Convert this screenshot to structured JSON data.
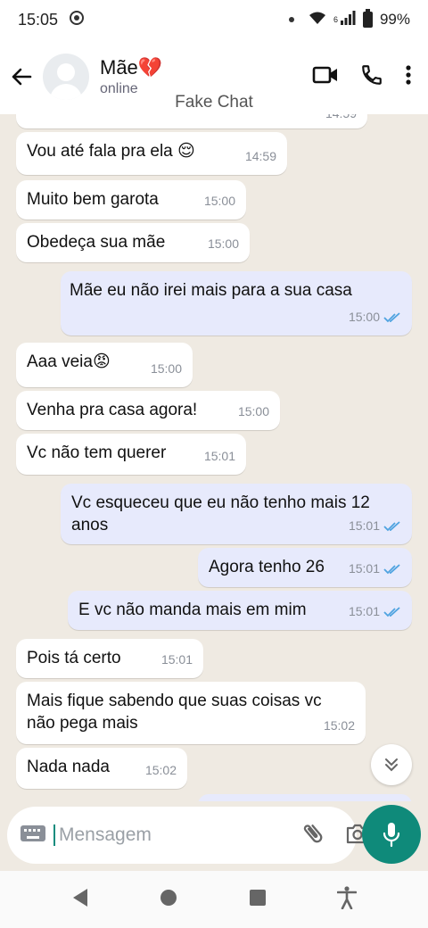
{
  "status_bar": {
    "time": "15:05",
    "signal": "6",
    "battery": "99%"
  },
  "header": {
    "name": "Mãe💔",
    "status": "online",
    "watermark": "Fake Chat"
  },
  "messages": [
    {
      "dir": "in",
      "text": "",
      "time": "14:59"
    },
    {
      "dir": "in",
      "text": "Vou até fala pra ela 😌",
      "time": "14:59"
    },
    {
      "dir": "in",
      "text": "Muito bem garota",
      "time": "15:00"
    },
    {
      "dir": "in",
      "text": "Obedeça sua mãe",
      "time": "15:00"
    },
    {
      "dir": "out",
      "text": "Mãe eu não irei mais para a sua casa",
      "time": "15:00"
    },
    {
      "dir": "in",
      "text": "Aaa veia😡",
      "time": "15:00"
    },
    {
      "dir": "in",
      "text": "Venha pra casa agora!",
      "time": "15:00"
    },
    {
      "dir": "in",
      "text": "Vc não tem querer",
      "time": "15:01"
    },
    {
      "dir": "out",
      "text": "Vc esqueceu que eu não tenho mais 12 anos",
      "time": "15:01"
    },
    {
      "dir": "out",
      "text": "Agora tenho 26",
      "time": "15:01"
    },
    {
      "dir": "out",
      "text": "E vc não manda mais em mim",
      "time": "15:01"
    },
    {
      "dir": "in",
      "text": "Pois tá certo",
      "time": "15:01"
    },
    {
      "dir": "in",
      "text": "Mais fique sabendo que suas coisas vc não pega mais",
      "time": "15:02"
    },
    {
      "dir": "in",
      "text": "Nada nada",
      "time": "15:02"
    }
  ],
  "composer": {
    "placeholder": "Mensagem"
  },
  "icons": {
    "back": "arrow-left-icon",
    "video": "video-camera-icon",
    "call": "phone-icon",
    "menu": "more-vertical-icon",
    "keyboard": "keyboard-icon",
    "attach": "paperclip-icon",
    "camera": "camera-icon",
    "mic": "microphone-icon",
    "scroll": "double-chevron-down-icon"
  },
  "colors": {
    "accent": "#0f8a7a",
    "outgoing_bubble": "#e7eafc",
    "tick": "#4fa3e0",
    "background": "#efeae2"
  }
}
